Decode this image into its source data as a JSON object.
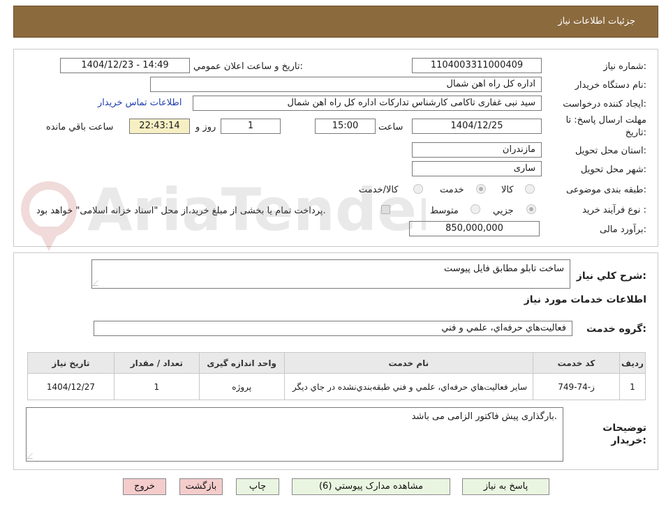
{
  "header": {
    "title": "جزئيات اطلاعات نياز"
  },
  "form": {
    "need_number_label": "شماره نياز:",
    "need_number": "1104003311000409",
    "announce_label": "تاريخ و ساعت اعلان عمومي:",
    "announce_value": "1404/12/23 - 14:49",
    "buyer_org_label": "نام دستگاه خريدار:",
    "buyer_org": "اداره کل راه اهن شمال",
    "creator_label": "ايجاد کننده درخواست:",
    "creator": "سید نبی غفاری تاکامی کارشناس تدارکات اداره کل راه اهن شمال",
    "contact_link": "اطلاعات تماس خريدار",
    "deadline_label_1": "مهلت ارسال پاسخ: تا",
    "deadline_label_2": "تاريخ:",
    "deadline_date": "1404/12/25",
    "time_label": "ساعت",
    "deadline_time": "15:00",
    "days_value": "1",
    "days_label": "روز و",
    "remaining_time": "22:43:14",
    "remaining_label": "ساعت باقي مانده",
    "province_label": "استان محل تحويل:",
    "province": "مازندران",
    "city_label": "شهر محل تحويل:",
    "city": "ساری",
    "category_label": "طبقه بندی موضوعی:",
    "category_options": [
      "کالا",
      "خدمت",
      "کالا/خدمت"
    ],
    "category_selected": "خدمت",
    "process_label": "نوع فرآيند خريد :",
    "process_options": [
      "جزيي",
      "متوسط"
    ],
    "process_selected": "جزيي",
    "payment_note": "پرداخت تمام يا بخشی از مبلغ خريد،از محل \"اسناد خزانه اسلامی\" خواهد بود.",
    "budget_label": "برآورد مالی:",
    "budget": "850,000,000"
  },
  "description": {
    "label": "شرح کلي نياز:",
    "value": "ساخت تابلو مطابق فایل پیوست"
  },
  "services": {
    "section_title": "اطلاعات خدمات مورد نياز",
    "group_label": "گروه خدمت:",
    "group_value": "فعاليت‌هاي حرفه‌اي، علمي و فني",
    "columns": [
      "رديف",
      "کد خدمت",
      "نام خدمت",
      "واحد اندازه گيری",
      "تعداد / مقدار",
      "تاريخ نياز"
    ],
    "rows": [
      {
        "index": "1",
        "code": "ز-74-749",
        "name": "ساير فعاليت‌هاي حرفه‌اي، علمي و فني طبقه‌بندي‌نشده در جاي ديگر",
        "unit": "پروژه",
        "qty": "1",
        "date": "1404/12/27"
      }
    ]
  },
  "buyer_notes": {
    "label_1": "توضيحات",
    "label_2": "خريدار:",
    "value": "بارگذاری پیش فاکتور الزامی می باشد."
  },
  "buttons": {
    "reply": "پاسخ به نياز",
    "attachments": "مشاهده مدارک پيوستي (6)",
    "print": "چاپ",
    "back": "بازگشت",
    "exit": "خروج"
  },
  "watermark": {
    "text": "AriaTender.net"
  },
  "colors": {
    "header": "#8b6a3e",
    "button_green": "#eaf5e1",
    "button_red": "#f4cccc",
    "timer_bg": "#f7efc4",
    "link": "#1f3fb0"
  }
}
